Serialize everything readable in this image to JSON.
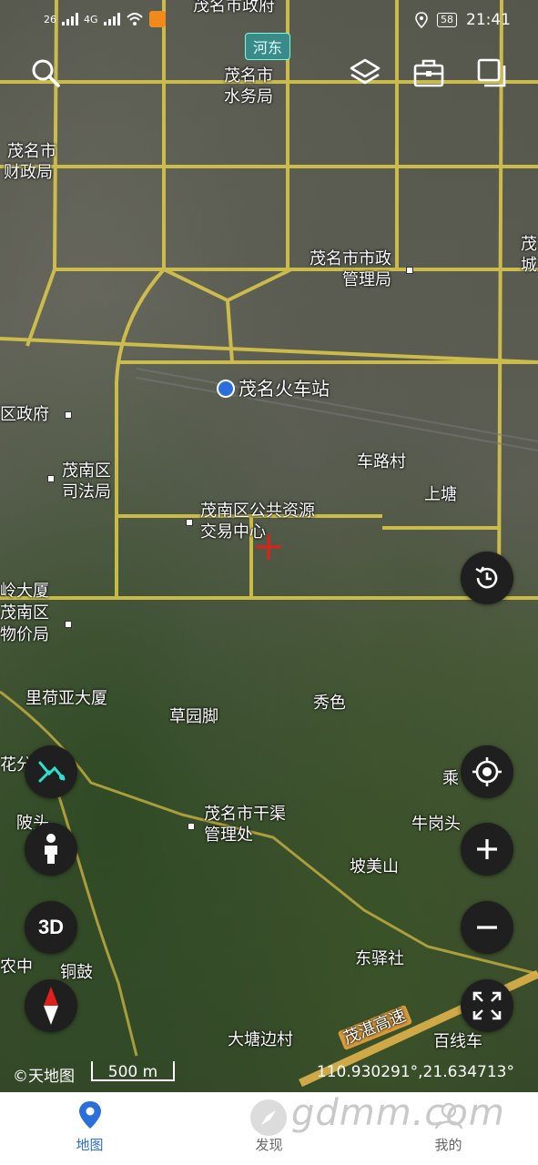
{
  "status_bar": {
    "signal_1": "26",
    "signal_2": "4G",
    "battery": "58",
    "time": "21:41"
  },
  "map": {
    "top_badge": "河东",
    "labels": [
      {
        "text": "茂名市政府"
      },
      {
        "text": "茂名市"
      },
      {
        "text": "水务局"
      },
      {
        "text": "茂名市"
      },
      {
        "text": "财政局"
      },
      {
        "text": "茂名市市政"
      },
      {
        "text": "管理局"
      },
      {
        "text": "茂名火车站"
      },
      {
        "text": "区政府"
      },
      {
        "text": "茂南区"
      },
      {
        "text": "司法局"
      },
      {
        "text": "车路村"
      },
      {
        "text": "茂南区公共资源"
      },
      {
        "text": "交易中心"
      },
      {
        "text": "上塘"
      },
      {
        "text": "岭大厦"
      },
      {
        "text": "茂南区"
      },
      {
        "text": "物价局"
      },
      {
        "text": "里荷亚大厦"
      },
      {
        "text": "秀色"
      },
      {
        "text": "草园脚"
      },
      {
        "text": "花分"
      },
      {
        "text": "陂头"
      },
      {
        "text": "茂名市干渠"
      },
      {
        "text": "管理处"
      },
      {
        "text": "牛岗头"
      },
      {
        "text": "坡美山"
      },
      {
        "text": "农中"
      },
      {
        "text": "铜鼓"
      },
      {
        "text": "东驿社"
      },
      {
        "text": "大塘边村"
      },
      {
        "text": "茂湛高速"
      },
      {
        "text": "百线车"
      },
      {
        "text": "茂"
      },
      {
        "text": "城"
      },
      {
        "text": "乘"
      }
    ]
  },
  "scale": {
    "attribution": "©天地图",
    "distance": "500 m",
    "coordinates": "110.930291°,21.634713°"
  },
  "tabs": [
    {
      "label": "地图",
      "icon": "location-pin-icon",
      "active": true
    },
    {
      "label": "发现",
      "icon": "compass-disc-icon",
      "active": false
    },
    {
      "label": "我的",
      "icon": "user-icon",
      "active": false
    }
  ],
  "watermark": "gdmm.com",
  "colors": {
    "road": "#d8c64a",
    "accent": "#2a6fdb",
    "fab_bg": "#1f1f1f",
    "marker": "#e0201b"
  }
}
